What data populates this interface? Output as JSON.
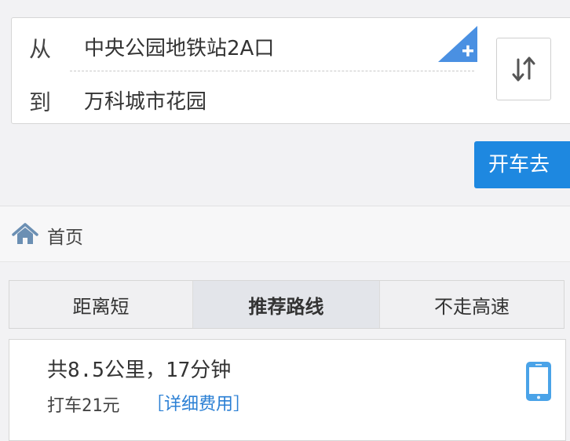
{
  "route": {
    "from_label": "从",
    "from_value": "中央公园地铁站2A口",
    "to_label": "到",
    "to_value": "万科城市花园",
    "add_icon": "plus-corner-icon",
    "swap_icon": "swap-arrows-icon"
  },
  "actions": {
    "drive_label": "开车去"
  },
  "breadcrumb": {
    "home_label": "首页",
    "home_icon": "home-icon"
  },
  "tabs": [
    {
      "label": "距离短"
    },
    {
      "label": "推荐路线",
      "active": true
    },
    {
      "label": "不走高速"
    }
  ],
  "result": {
    "summary": "共8.5公里，17分钟",
    "taxi_text": "打车21元",
    "fare_link": "［详细费用］",
    "phone_icon": "phone-icon"
  },
  "colors": {
    "accent": "#1e88e0",
    "link": "#2a7fd4",
    "corner": "#4a90e2"
  }
}
